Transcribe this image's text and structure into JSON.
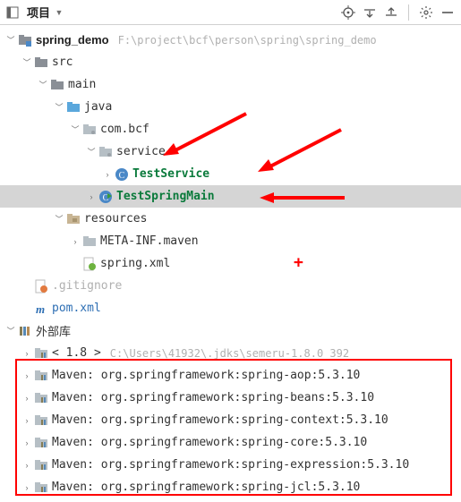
{
  "toolbar": {
    "project_label": "项目"
  },
  "tree": {
    "root": {
      "name": "spring_demo",
      "path": "F:\\project\\bcf\\person\\spring\\spring_demo"
    },
    "src": "src",
    "main": "main",
    "java": "java",
    "pkg": "com.bcf",
    "service": "service",
    "testService": "TestService",
    "testSpringMain": "TestSpringMain",
    "resources": "resources",
    "metaInf": "META-INF.maven",
    "springXml": "spring.xml",
    "gitignore": ".gitignore",
    "pom": "pom.xml",
    "externalLibs": "外部库",
    "sdk": {
      "label": "< 1.8 >",
      "path": "C:\\Users\\41932\\.jdks\\semeru-1.8.0_392"
    },
    "maven": [
      "Maven: org.springframework:spring-aop:5.3.10",
      "Maven: org.springframework:spring-beans:5.3.10",
      "Maven: org.springframework:spring-context:5.3.10",
      "Maven: org.springframework:spring-core:5.3.10",
      "Maven: org.springframework:spring-expression:5.3.10",
      "Maven: org.springframework:spring-jcl:5.3.10"
    ]
  }
}
